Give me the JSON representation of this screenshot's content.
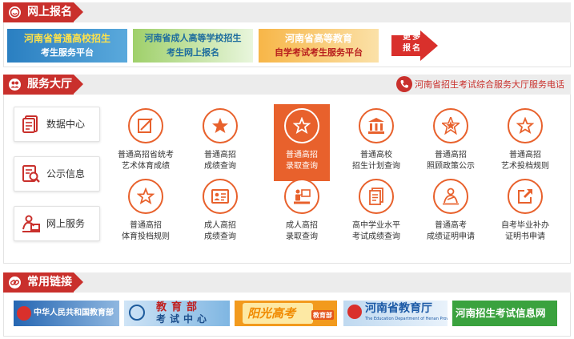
{
  "section_register": {
    "title": "网上报名",
    "banners": [
      {
        "line1": "河南省普通高校招生",
        "line2": "考生服务平台"
      },
      {
        "line1": "河南省成人高等学校招生",
        "line2": "考生网上报名"
      },
      {
        "line1": "河南省高等教育",
        "line2": "自学考试考生服务平台"
      }
    ],
    "more": {
      "line1": "更",
      "line2": "多",
      "line3": "报",
      "line4": "名"
    }
  },
  "section_service": {
    "title": "服务大厅",
    "hotline": "河南省招生考试综合服务大厅服务电话",
    "left_nav": [
      {
        "label": "数据中心",
        "icon": "document-icon"
      },
      {
        "label": "公示信息",
        "icon": "search-document-icon"
      },
      {
        "label": "网上服务",
        "icon": "person-desk-icon"
      }
    ],
    "services": [
      {
        "line1": "普通高招省统考",
        "line2": "艺术体育成绩",
        "icon": "edit-icon",
        "active": false
      },
      {
        "line1": "普通高招",
        "line2": "成绩查询",
        "icon": "star-icon",
        "active": false
      },
      {
        "line1": "普通高招",
        "line2": "录取查询",
        "icon": "star-outline-icon",
        "active": true
      },
      {
        "line1": "普通高校",
        "line2": "招生计划查询",
        "icon": "institution-icon",
        "active": false
      },
      {
        "line1": "普通高招",
        "line2": "照顾政策公示",
        "icon": "star-badge-icon",
        "active": false
      },
      {
        "line1": "普通高招",
        "line2": "艺术投档规则",
        "icon": "star-outline-icon",
        "active": false
      },
      {
        "line1": "普通高招",
        "line2": "体育投档规则",
        "icon": "star-outline-icon",
        "active": false
      },
      {
        "line1": "成人高招",
        "line2": "成绩查询",
        "icon": "id-card-icon",
        "active": false
      },
      {
        "line1": "成人高招",
        "line2": "录取查询",
        "icon": "presenter-icon",
        "active": false
      },
      {
        "line1": "高中学业水平",
        "line2": "考试成绩查询",
        "icon": "document-stack-icon",
        "active": false
      },
      {
        "line1": "普通高考",
        "line2": "成绩证明申请",
        "icon": "person-icon",
        "active": false
      },
      {
        "line1": "自考毕业补办",
        "line2": "证明书申请",
        "icon": "external-link-icon",
        "active": false
      }
    ]
  },
  "section_links": {
    "title": "常用链接",
    "links": [
      {
        "label": "中华人民共和国教育部"
      },
      {
        "label": "教育部",
        "sub": "考试中心"
      },
      {
        "label": "阳光高考",
        "badge": "教育部"
      },
      {
        "label": "河南省教育厅",
        "sub": "The Education Department of Henan Province"
      },
      {
        "label": "河南招生考试信息网"
      }
    ]
  },
  "colors": {
    "brand_red": "#c9302c",
    "accent_orange": "#e8612c",
    "tab_bar_grey": "#ececec"
  }
}
